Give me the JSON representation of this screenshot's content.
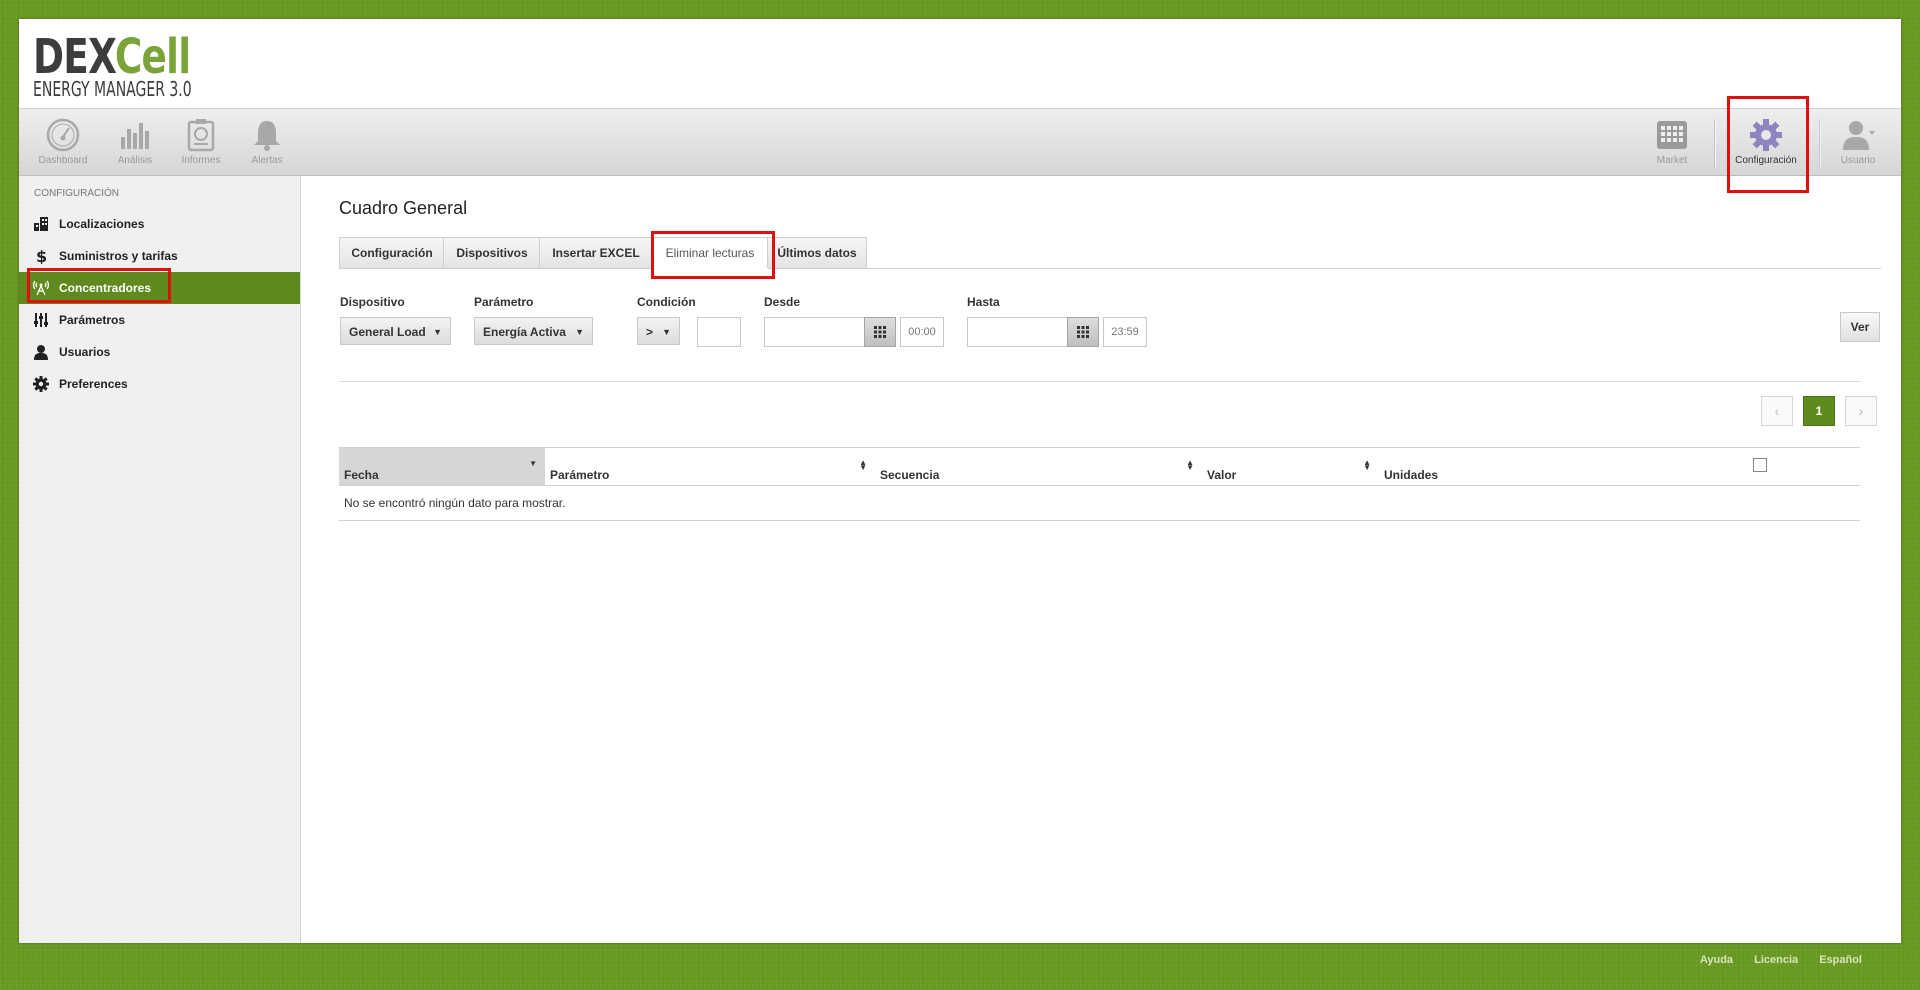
{
  "logo": {
    "brand_part1": "DEX",
    "brand_part2": "Cell",
    "subtitle": "ENERGY MANAGER 3.0"
  },
  "toolbar": {
    "dashboard": "Dashboard",
    "analisis": "Análisis",
    "informes": "Informes",
    "alertas": "Alertas",
    "market": "Market",
    "configuracion": "Configuración",
    "usuario": "Usuario"
  },
  "sidebar": {
    "title": "CONFIGURACIÓN",
    "items": [
      {
        "label": "Localizaciones",
        "icon": "buildings-icon"
      },
      {
        "label": "Suministros y tarifas",
        "icon": "dollar-icon"
      },
      {
        "label": "Concentradores",
        "icon": "antenna-icon",
        "active": true
      },
      {
        "label": "Parámetros",
        "icon": "sliders-icon"
      },
      {
        "label": "Usuarios",
        "icon": "user-icon"
      },
      {
        "label": "Preferences",
        "icon": "gear-icon"
      }
    ]
  },
  "main": {
    "title": "Cuadro General",
    "tabs": [
      {
        "label": "Configuración"
      },
      {
        "label": "Dispositivos"
      },
      {
        "label": "Insertar EXCEL"
      },
      {
        "label": "Eliminar lecturas",
        "active": true
      },
      {
        "label": "Últimos datos"
      }
    ],
    "filters": {
      "dispositivo_label": "Dispositivo",
      "dispositivo_value": "General Load",
      "parametro_label": "Parámetro",
      "parametro_value": "Energía Activa",
      "condicion_label": "Condición",
      "condicion_value": ">",
      "condicion_input": "",
      "desde_label": "Desde",
      "desde_date": "",
      "desde_time": "00:00",
      "hasta_label": "Hasta",
      "hasta_date": "",
      "hasta_time": "23:59",
      "ver_button": "Ver"
    },
    "pager": {
      "current": "1",
      "prev": "‹",
      "next": "›"
    },
    "table": {
      "columns": [
        "Fecha",
        "Parámetro",
        "Secuencia",
        "Valor",
        "Unidades"
      ],
      "empty_message": "No se encontró ningún dato para mostrar."
    }
  },
  "footer": {
    "ayuda": "Ayuda",
    "licencia": "Licencia",
    "idioma": "Español"
  },
  "colors": {
    "accent": "#5f8a1e",
    "highlight": "#e01010",
    "background": "#6a9a24"
  }
}
